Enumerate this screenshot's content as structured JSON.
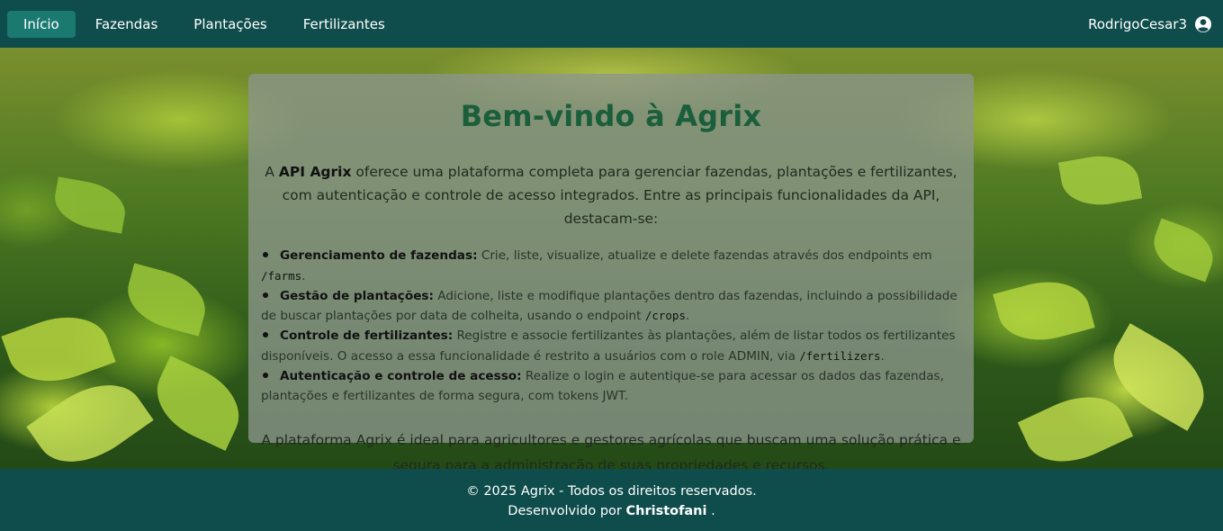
{
  "nav": {
    "links": [
      {
        "label": "Início",
        "active": true
      },
      {
        "label": "Fazendas",
        "active": false
      },
      {
        "label": "Plantações",
        "active": false
      },
      {
        "label": "Fertilizantes",
        "active": false
      }
    ],
    "username": "RodrigoCesar3",
    "user_icon": "account-circle-icon"
  },
  "colors": {
    "navbar": "#0f4c4c",
    "active_tab": "#1a7a72",
    "title": "#1b5e3c"
  },
  "main": {
    "title": "Bem-vindo à Agrix",
    "intro_prefix": "A ",
    "intro_bold": "API Agrix",
    "intro_rest": " oferece uma plataforma completa para gerenciar fazendas, plantações e fertilizantes, com autenticação e controle de acesso integrados. Entre as principais funcionalidades da API, destacam-se:",
    "features": [
      {
        "title": "Gerenciamento de fazendas:",
        "text": " Crie, liste, visualize, atualize e delete fazendas através dos endpoints em ",
        "code": "/farms",
        "end": "."
      },
      {
        "title": "Gestão de plantações:",
        "text": " Adicione, liste e modifique plantações dentro das fazendas, incluindo a possibilidade de buscar plantações por data de colheita, usando o endpoint ",
        "code": "/crops",
        "end": "."
      },
      {
        "title": "Controle de fertilizantes:",
        "text": " Registre e associe fertilizantes às plantações, além de listar todos os fertilizantes disponíveis. O acesso a essa funcionalidade é restrito a usuários com o role ADMIN, via ",
        "code": "/fertilizers",
        "end": "."
      },
      {
        "title": "Autenticação e controle de acesso:",
        "text": " Realize o login e autentique-se para acessar os dados das fazendas, plantações e fertilizantes de forma segura, com tokens JWT.",
        "code": "",
        "end": ""
      }
    ],
    "outro": "A plataforma Agrix é ideal para agricultores e gestores agrícolas que buscam uma solução prática e segura para a administração de suas propriedades e recursos."
  },
  "footer": {
    "copyright": "© 2025 Agrix - Todos os direitos reservados.",
    "dev_prefix": "Desenvolvido por ",
    "dev_name": "Christofani",
    "dev_suffix": " ."
  }
}
